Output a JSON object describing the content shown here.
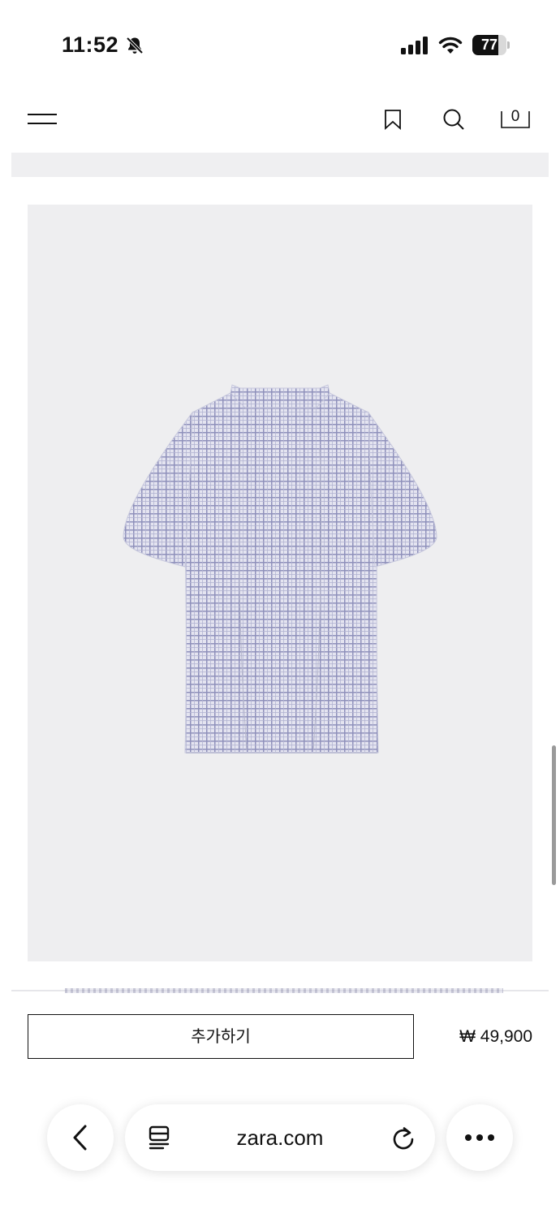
{
  "status_bar": {
    "time": "11:52",
    "battery_level": "77",
    "icons": [
      "bell-slash-icon",
      "signal-icon",
      "wifi-icon",
      "battery-icon"
    ]
  },
  "header": {
    "bag_count": "0",
    "icons": [
      "menu-icon",
      "bookmark-icon",
      "search-icon",
      "bag-icon"
    ]
  },
  "product": {
    "image_icon": "shirt-back-view",
    "add_button_label": "추가하기",
    "price": "₩ 49,900"
  },
  "browser": {
    "url": "zara.com",
    "icons": [
      "back-icon",
      "tabs-icon",
      "reload-icon",
      "more-icon"
    ]
  },
  "colors": {
    "background": "#ffffff",
    "image_background": "#eeeef0",
    "text": "#111111"
  }
}
